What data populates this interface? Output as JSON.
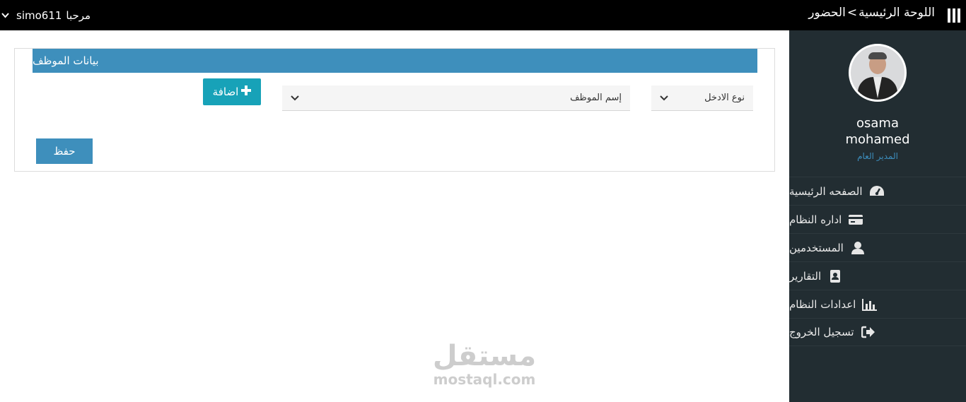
{
  "topbar": {
    "greeting": "مرحبا",
    "username": "simo611",
    "breadcrumb_home": "اللوحة الرئيسية",
    "breadcrumb_sep": ">",
    "breadcrumb_current": "الحضور"
  },
  "sidebar": {
    "profile": {
      "first_name": "osama",
      "last_name": "mohamed",
      "role": "المدير العام"
    },
    "items": [
      {
        "label": "الصفحه الرئيسية",
        "icon": "dashboard-icon"
      },
      {
        "label": "اداره النظام",
        "icon": "credit-card-icon"
      },
      {
        "label": "المستخدمين",
        "icon": "user-icon"
      },
      {
        "label": "التقارير",
        "icon": "address-book-icon"
      },
      {
        "label": "اعدادات النظام",
        "icon": "bar-chart-icon"
      },
      {
        "label": "تسجيل الخروج",
        "icon": "sign-out-icon"
      }
    ]
  },
  "main": {
    "panel_title": "بيانات الموظف",
    "entry_type_select": "نوع الادخل",
    "employee_name_select": "إسم الموظف",
    "add_button": "اضافة",
    "save_button": "حفظ"
  },
  "watermark": {
    "arabic": "مستقل",
    "latin": "mostaql.com"
  },
  "colors": {
    "topbar": "#000000",
    "sidebar": "#222d32",
    "accent": "#3e8fbc",
    "add_button": "#17a2b8",
    "role_text": "#3c8dbc"
  }
}
